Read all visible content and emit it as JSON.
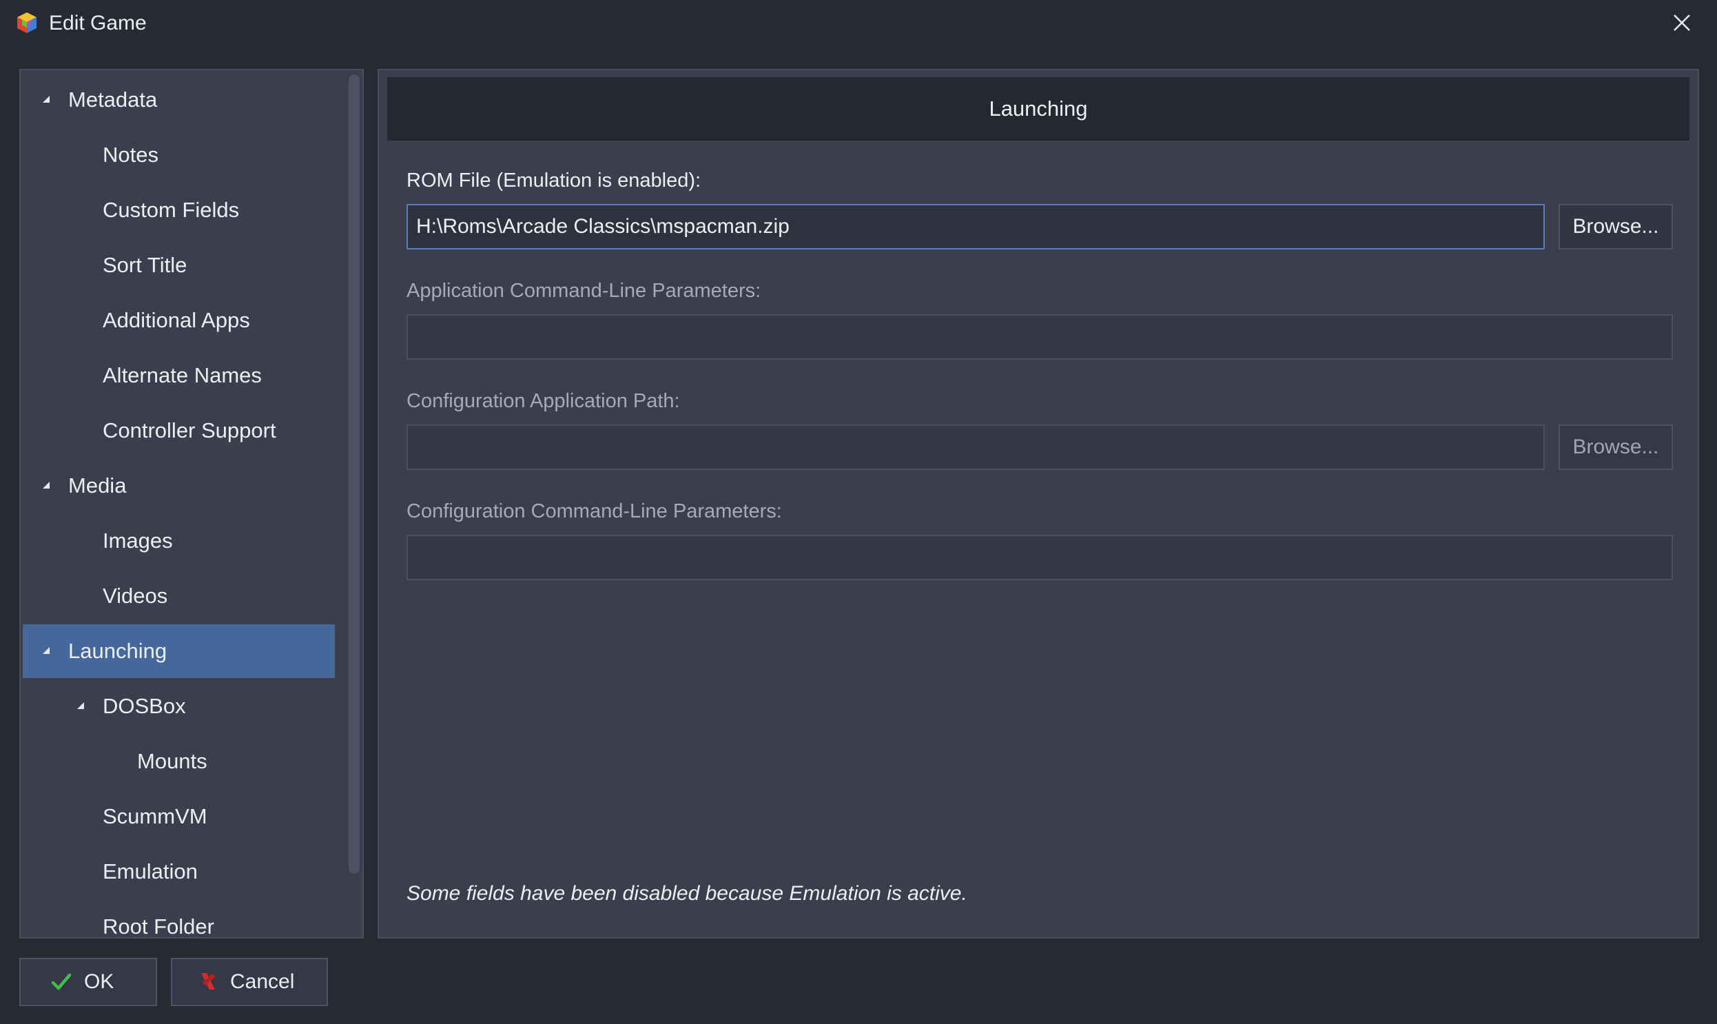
{
  "window": {
    "title": "Edit Game",
    "icon": "launchbox-cube-icon",
    "close_icon": "close-icon"
  },
  "tree": {
    "items": [
      {
        "label": "Metadata",
        "level": 0,
        "expanded": true,
        "selected": false
      },
      {
        "label": "Notes",
        "level": 1,
        "selected": false
      },
      {
        "label": "Custom Fields",
        "level": 1,
        "selected": false
      },
      {
        "label": "Sort Title",
        "level": 1,
        "selected": false
      },
      {
        "label": "Additional Apps",
        "level": 1,
        "selected": false
      },
      {
        "label": "Alternate Names",
        "level": 1,
        "selected": false
      },
      {
        "label": "Controller Support",
        "level": 1,
        "selected": false
      },
      {
        "label": "Media",
        "level": 0,
        "expanded": true,
        "selected": false
      },
      {
        "label": "Images",
        "level": 1,
        "selected": false
      },
      {
        "label": "Videos",
        "level": 1,
        "selected": false
      },
      {
        "label": "Launching",
        "level": 0,
        "expanded": true,
        "selected": true
      },
      {
        "label": "DOSBox",
        "level": 1,
        "expanded": true,
        "selected": false
      },
      {
        "label": "Mounts",
        "level": 2,
        "selected": false
      },
      {
        "label": "ScummVM",
        "level": 1,
        "selected": false
      },
      {
        "label": "Emulation",
        "level": 1,
        "selected": false
      },
      {
        "label": "Root Folder",
        "level": 1,
        "selected": false
      }
    ]
  },
  "content": {
    "header": "Launching",
    "rom_file": {
      "label": "ROM File (Emulation is enabled):",
      "value": "H:\\Roms\\Arcade Classics\\mspacman.zip",
      "browse_label": "Browse..."
    },
    "app_params": {
      "label": "Application Command-Line Parameters:",
      "value": ""
    },
    "config_app_path": {
      "label": "Configuration Application Path:",
      "value": "",
      "browse_label": "Browse..."
    },
    "config_params": {
      "label": "Configuration Command-Line Parameters:",
      "value": ""
    },
    "note": "Some fields have been disabled because Emulation is active."
  },
  "buttons": {
    "ok_label": "OK",
    "cancel_label": "Cancel"
  },
  "colors": {
    "background": "#272a33",
    "panel": "#3b3e4d",
    "selection": "#44679c",
    "header": "#252830",
    "ok_check": "#3fbf4a",
    "cancel_x": "#d82c2c"
  }
}
